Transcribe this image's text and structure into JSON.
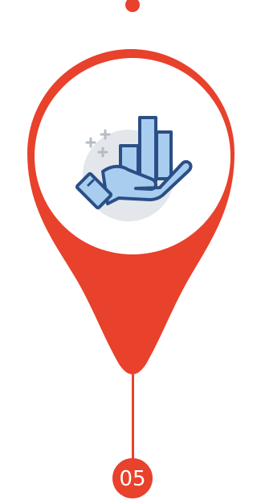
{
  "step": {
    "number": "05"
  },
  "icon": {
    "name": "hand-holding-bar-chart-icon"
  },
  "colors": {
    "pin": "#e8412c",
    "icon_outline": "#2a4f86",
    "icon_fill": "#a9cdef",
    "icon_backdrop": "#e3e6ea",
    "sparkle": "#b6bcc4",
    "background": "#ffffff"
  }
}
